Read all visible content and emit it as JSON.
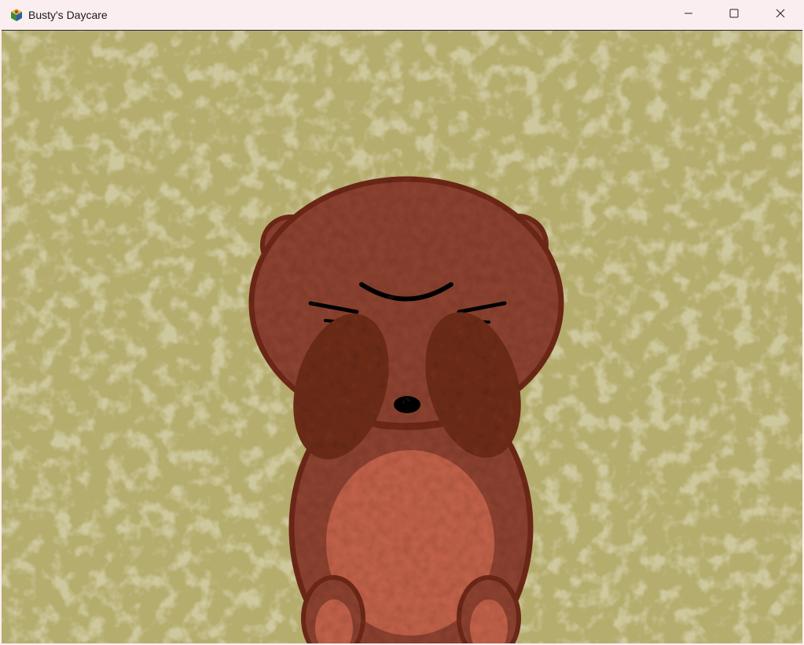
{
  "window": {
    "title": "Busty's Daycare",
    "icon": "game-cube-icon",
    "controls": {
      "minimize": "minimize-icon",
      "maximize": "maximize-icon",
      "close": "close-icon"
    }
  },
  "scene": {
    "background_color": "#b5ad6e",
    "background_speckle_color": "#9e9558",
    "character": {
      "fur_color": "#8c4330",
      "fur_outline_color": "#6e2a1c",
      "paw_color": "#6d2d1d",
      "belly_color": "#bf6149",
      "inner_ear_color": "#c7705a",
      "feature_color": "#111111"
    }
  }
}
